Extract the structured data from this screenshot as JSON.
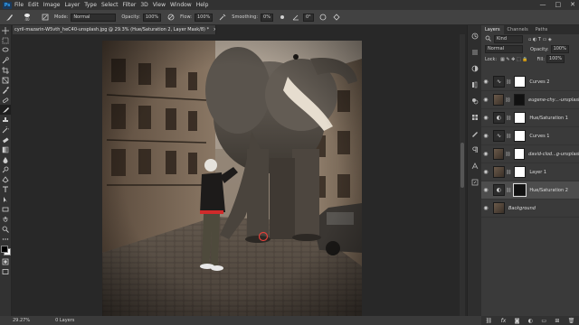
{
  "menu": {
    "app_logo": "Ps",
    "items": [
      "File",
      "Edit",
      "Image",
      "Layer",
      "Type",
      "Select",
      "Filter",
      "3D",
      "View",
      "Window",
      "Help"
    ],
    "window_controls": [
      "—",
      "□",
      "✕"
    ]
  },
  "options": {
    "brush_size": "40",
    "mode_label": "Mode:",
    "mode_value": "Normal",
    "opacity_label": "Opacity:",
    "opacity_value": "100%",
    "flow_label": "Flow:",
    "flow_value": "100%",
    "smoothing_label": "Smoothing:",
    "smoothing_value": "0%",
    "angle_value": "0°"
  },
  "document": {
    "tab_title": "cyril-mazarin-W5vth_heC40-unsplash.jpg @ 29.3% (Hue/Saturation 2, Layer Mask/8) *",
    "close_glyph": "×"
  },
  "status": {
    "zoom": "29.27%",
    "info": "0 Layers"
  },
  "panel": {
    "tabs": [
      "Layers",
      "Channels",
      "Paths"
    ],
    "kind_label": "Kind",
    "blend_mode": "Normal",
    "opacity_label": "Opacity:",
    "opacity_value": "100%",
    "lock_label": "Lock:",
    "fill_label": "Fill:",
    "fill_value": "100%",
    "layers": [
      {
        "name": "Curves 2",
        "thumb": "adj",
        "mask": "white",
        "selected": false,
        "italic": false
      },
      {
        "name": "eugene-chy...-unsplash",
        "thumb": "photo",
        "mask": "black",
        "selected": false,
        "italic": true
      },
      {
        "name": "Hue/Saturation 1",
        "thumb": "adj",
        "mask": "white",
        "selected": false,
        "italic": false
      },
      {
        "name": "Curves 1",
        "thumb": "adj",
        "mask": "white",
        "selected": false,
        "italic": false
      },
      {
        "name": "david-clod...g-unsplash",
        "thumb": "photo",
        "mask": "white",
        "selected": false,
        "italic": true
      },
      {
        "name": "Layer 1",
        "thumb": "photo",
        "mask": "white",
        "selected": false,
        "italic": false
      },
      {
        "name": "Hue/Saturation 2",
        "thumb": "adj",
        "mask": "black",
        "selected": true,
        "italic": false
      },
      {
        "name": "Background",
        "thumb": "photo",
        "mask": "",
        "selected": false,
        "italic": true
      }
    ],
    "footer_icons": [
      "link-icon",
      "fx-icon",
      "mask-icon",
      "adjustment-icon",
      "folder-icon",
      "new-layer-icon",
      "trash-icon"
    ]
  },
  "colors": {
    "accent": "#31a8ff",
    "brush_ring": "#e0403a",
    "shirt": "#d02a2a"
  }
}
